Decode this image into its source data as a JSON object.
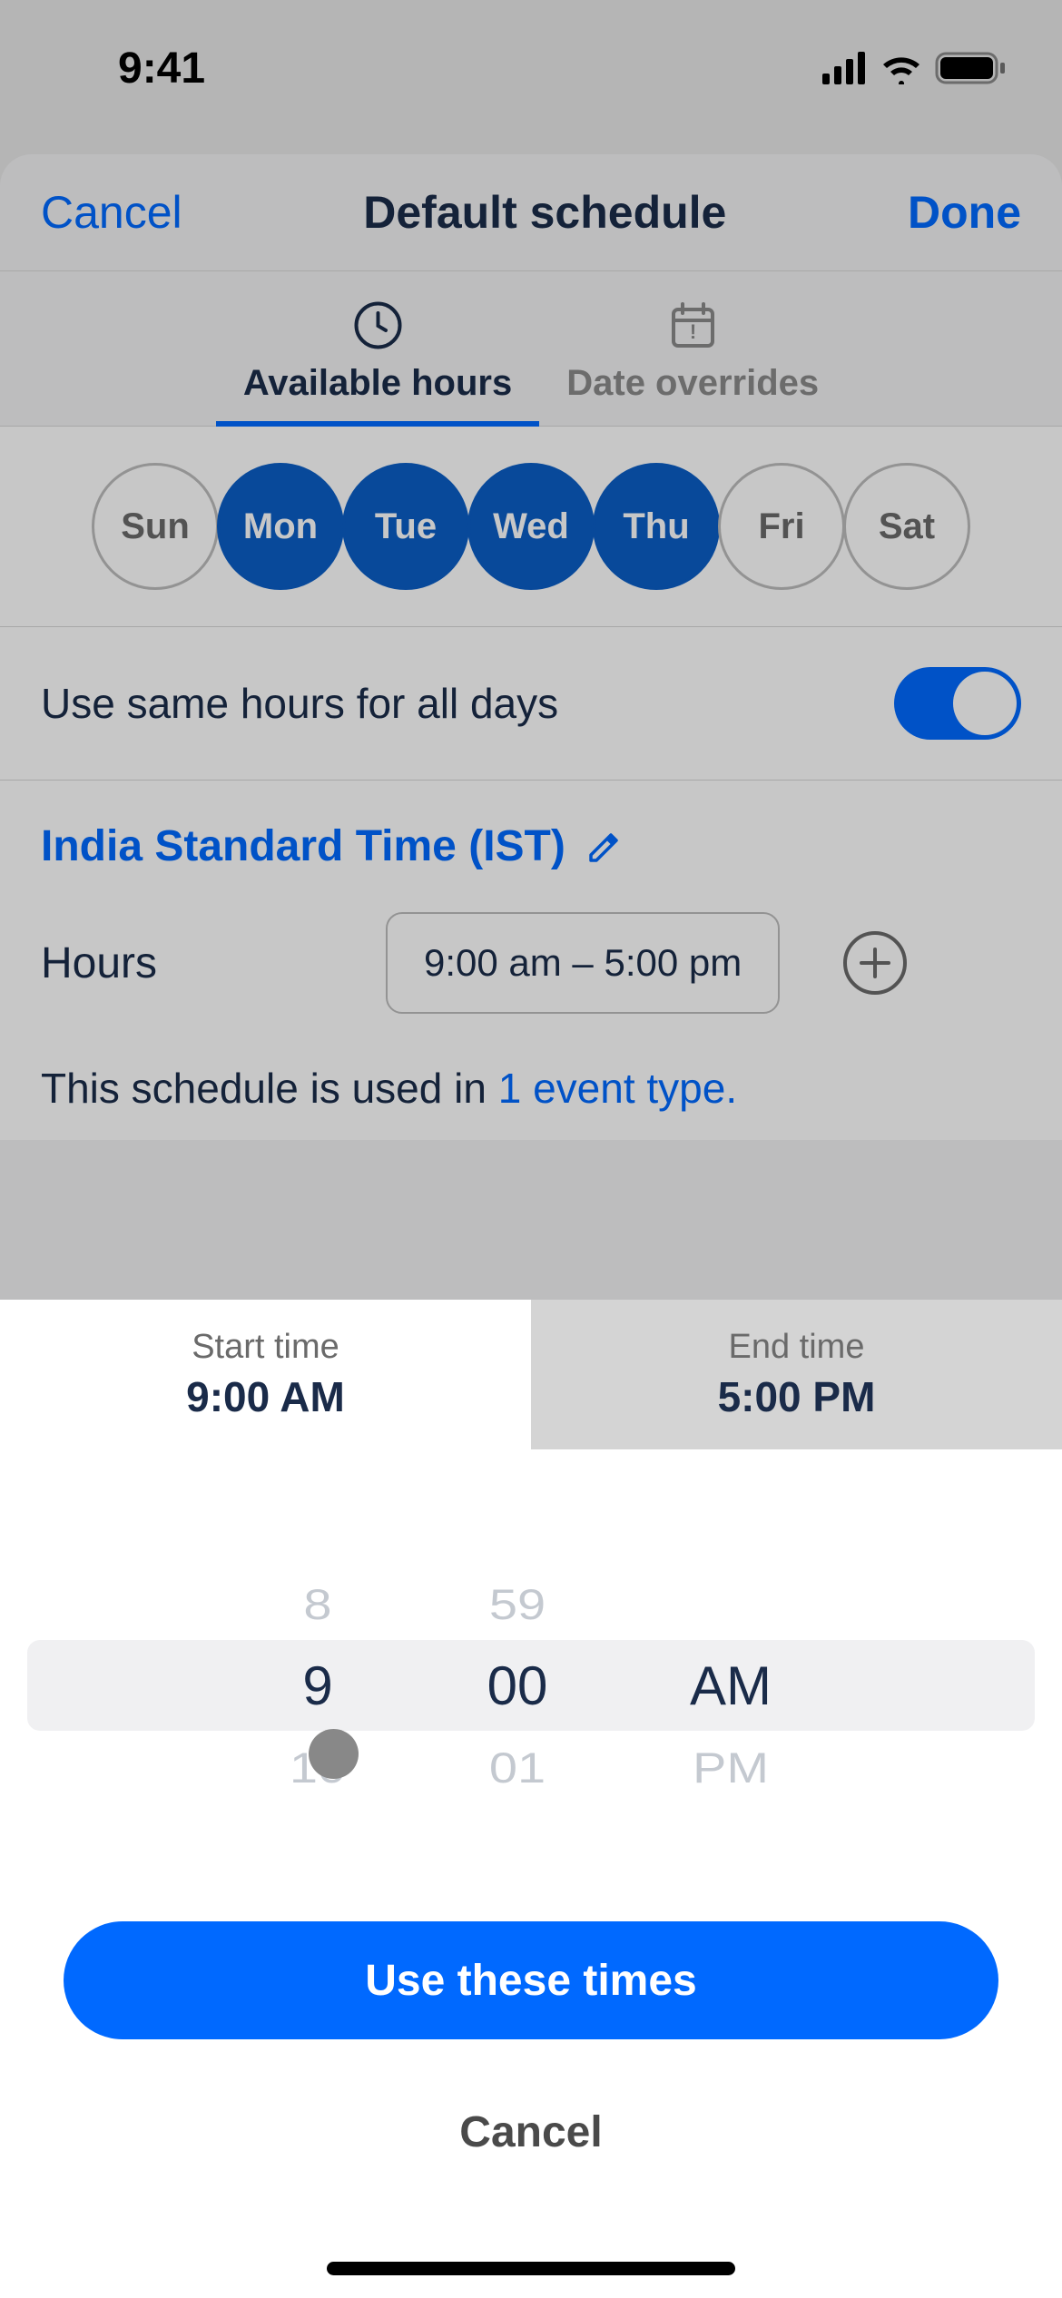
{
  "status": {
    "time": "9:41"
  },
  "sheet": {
    "cancel": "Cancel",
    "title": "Default schedule",
    "done": "Done"
  },
  "tabs": {
    "available": "Available hours",
    "overrides": "Date overrides"
  },
  "days": {
    "items": [
      {
        "label": "Sun",
        "selected": false
      },
      {
        "label": "Mon",
        "selected": true
      },
      {
        "label": "Tue",
        "selected": true
      },
      {
        "label": "Wed",
        "selected": true
      },
      {
        "label": "Thu",
        "selected": true
      },
      {
        "label": "Fri",
        "selected": false
      },
      {
        "label": "Sat",
        "selected": false
      }
    ]
  },
  "toggle": {
    "label": "Use same hours for all days",
    "value": true
  },
  "timezone": {
    "label": "India Standard Time (IST)"
  },
  "hours": {
    "label": "Hours",
    "range": "9:00 am – 5:00 pm"
  },
  "usage": {
    "prefix": "This schedule is used in ",
    "link": "1 event type."
  },
  "picker": {
    "start_label": "Start time",
    "start_value": "9:00 AM",
    "end_label": "End time",
    "end_value": "5:00 PM",
    "wheel": {
      "hour_prev": "8",
      "hour_sel": "9",
      "hour_next": "10",
      "min_prev": "59",
      "min_sel": "00",
      "min_next": "01",
      "period_sel": "AM",
      "period_next": "PM"
    },
    "confirm": "Use these times",
    "cancel": "Cancel"
  }
}
